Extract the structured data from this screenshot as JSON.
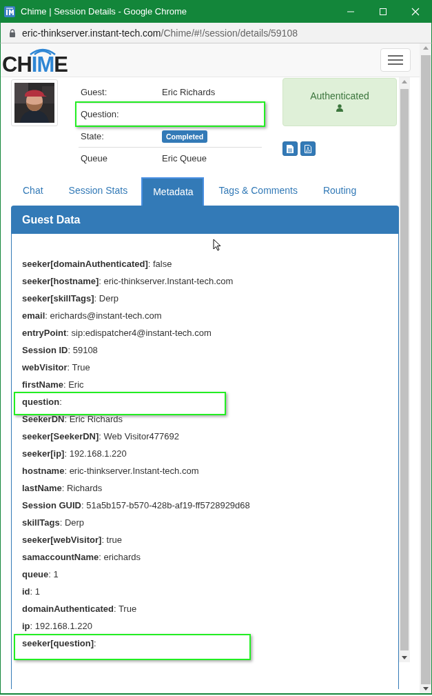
{
  "window": {
    "title": "Chime | Session Details - Google Chrome"
  },
  "address_bar": {
    "host": "eric-thinkserver.instant-tech.com",
    "path": "/Chime/#!/session/details/59108"
  },
  "logo": {
    "parts": [
      {
        "text": "CH",
        "accent": false
      },
      {
        "text": "IM",
        "accent": true
      },
      {
        "text": "E",
        "accent": false
      }
    ]
  },
  "details": [
    {
      "label": "Guest:",
      "value": "Eric Richards",
      "kind": "text",
      "highlighted": false
    },
    {
      "label": "Question:",
      "kind": "text",
      "highlighted": true
    },
    {
      "label": "State:",
      "value": "Completed",
      "kind": "badge",
      "highlighted": false
    },
    {
      "label": "Queue",
      "value": "Eric Queue",
      "kind": "text",
      "highlighted": false
    }
  ],
  "auth_status": {
    "label": "Authenticated"
  },
  "tabs": [
    {
      "label": "Chat",
      "selected": false
    },
    {
      "label": "Session Stats",
      "selected": false
    },
    {
      "label": "Metadata",
      "selected": true
    },
    {
      "label": "Tags & Comments",
      "selected": false
    },
    {
      "label": "Routing",
      "selected": false
    }
  ],
  "panel": {
    "title": "Guest Data",
    "items": [
      {
        "text": "**seeker[domainAuthenticated]**: false",
        "highlighted": false
      },
      {
        "text": "**seeker[hostname]**: eric-thinkserver.Instant-tech.com",
        "highlighted": false
      },
      {
        "text": "**seeker[skillTags]**: Derp",
        "highlighted": false
      },
      {
        "text": "**email**: erichards@instant-tech.com",
        "highlighted": false
      },
      {
        "text": "**entryPoint**: sip:edispatcher4@instant-tech.com",
        "highlighted": false
      },
      {
        "text": "**Session ID**: 59108",
        "highlighted": false
      },
      {
        "text": "**webVisitor**: True",
        "highlighted": false
      },
      {
        "text": "**firstName**: Eric",
        "highlighted": false
      },
      {
        "text": "**question**:",
        "highlighted": true
      },
      {
        "text": "**SeekerDN**: Eric Richards",
        "highlighted": false
      },
      {
        "text": "**seeker[SeekerDN]**: Web Visitor477692",
        "highlighted": false
      },
      {
        "text": "**seeker[ip]**: 192.168.1.220",
        "highlighted": false
      },
      {
        "text": "**hostname**: eric-thinkserver.Instant-tech.com",
        "highlighted": false
      },
      {
        "text": "**lastName**: Richards",
        "highlighted": false
      },
      {
        "text": "**Session GUID**: 51a5b157-b570-428b-af19-ff5728929d68",
        "highlighted": false
      },
      {
        "text": "**skillTags**: Derp",
        "highlighted": false
      },
      {
        "text": "**seeker[webVisitor]**: true",
        "highlighted": false
      },
      {
        "text": "**samaccountName**: erichards",
        "highlighted": false
      },
      {
        "text": "**queue**: 1",
        "highlighted": false
      },
      {
        "text": "**id**: 1",
        "highlighted": false
      },
      {
        "text": "**domainAuthenticated**: True",
        "highlighted": false
      },
      {
        "text": "**ip**: 192.168.1.220",
        "highlighted": false
      },
      {
        "text": "**seeker[question]**:",
        "highlighted": true
      }
    ]
  }
}
